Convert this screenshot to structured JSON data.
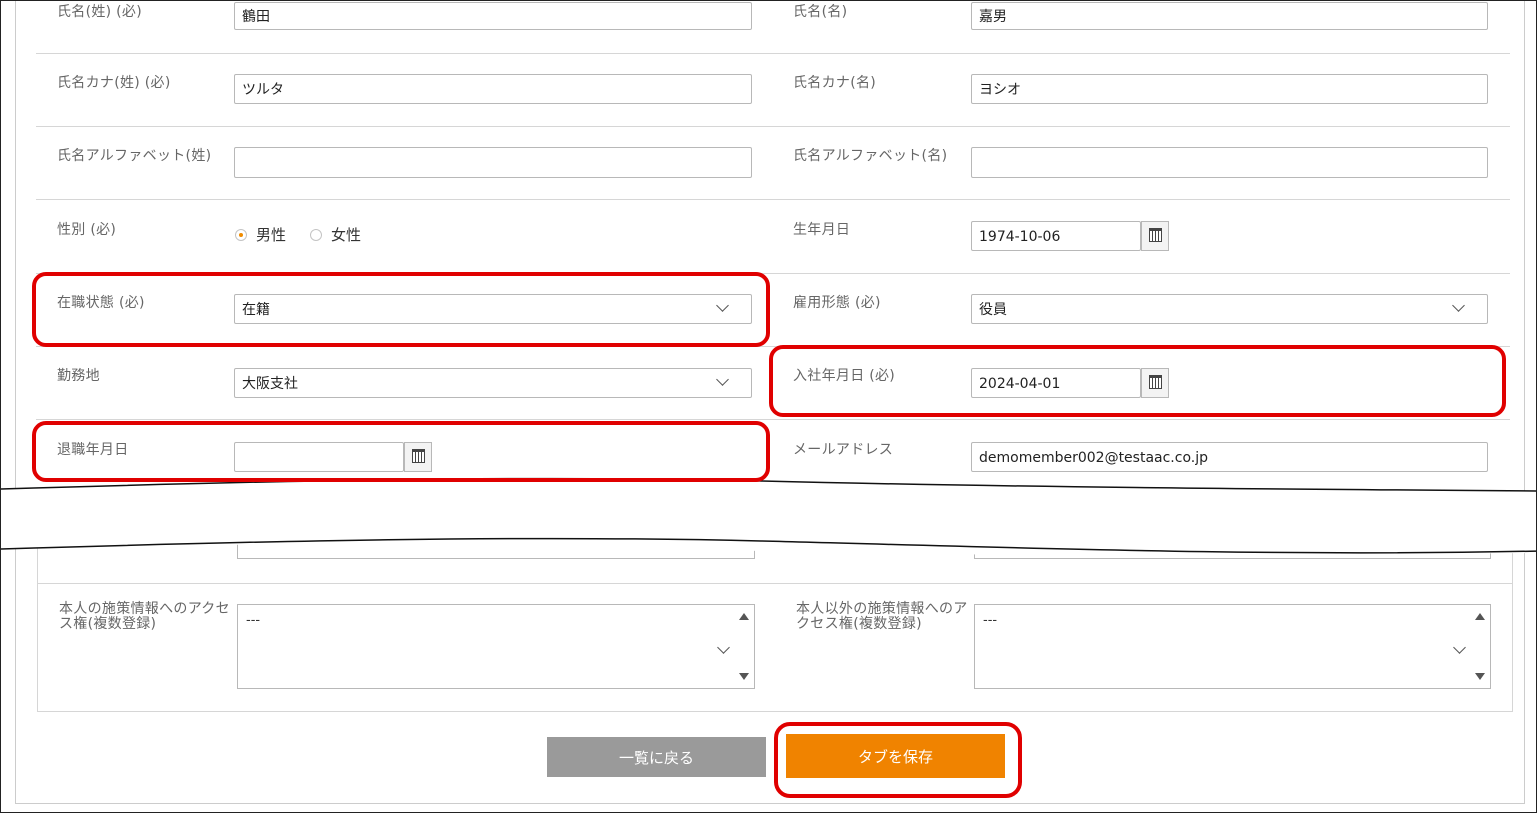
{
  "form": {
    "rows": [
      {
        "left": {
          "label": "氏名(姓) (必)",
          "value": "鶴田"
        },
        "right": {
          "label": "氏名(名)",
          "value": "嘉男"
        }
      },
      {
        "left": {
          "label": "氏名カナ(姓) (必)",
          "value": "ツルタ"
        },
        "right": {
          "label": "氏名カナ(名)",
          "value": "ヨシオ"
        }
      },
      {
        "left": {
          "label": "氏名アルファベット(姓)",
          "value": ""
        },
        "right": {
          "label": "氏名アルファベット(名)",
          "value": ""
        }
      },
      {
        "left": {
          "label": "性別 (必)",
          "options": [
            "男性",
            "女性"
          ],
          "selected": "男性"
        },
        "right": {
          "label": "生年月日",
          "value": "1974-10-06"
        }
      },
      {
        "left": {
          "label": "在職状態 (必)",
          "value": "在籍"
        },
        "right": {
          "label": "雇用形態 (必)",
          "value": "役員"
        }
      },
      {
        "left": {
          "label": "勤務地",
          "value": "大阪支社"
        },
        "right": {
          "label": "入社年月日 (必)",
          "value": "2024-04-01"
        }
      },
      {
        "left": {
          "label": "退職年月日",
          "value": ""
        },
        "right": {
          "label": "メールアドレス",
          "value": "demomember002@testaac.co.jp"
        }
      }
    ],
    "access": {
      "left": {
        "label": "本人の施策情報へのアクセス権(複数登録)",
        "value": "---"
      },
      "right": {
        "label": "本人以外の施策情報へのアクセス権(複数登録)",
        "value": "---"
      }
    }
  },
  "buttons": {
    "back": "一覧に戻る",
    "save": "タブを保存"
  },
  "colors": {
    "highlight": "#e00000",
    "save_button": "#f08300",
    "back_button": "#9a9a9a",
    "radio_accent": "#f08c00"
  },
  "icons": {
    "calendar": "calendar-icon",
    "dropdown": "chevron-down-icon"
  }
}
